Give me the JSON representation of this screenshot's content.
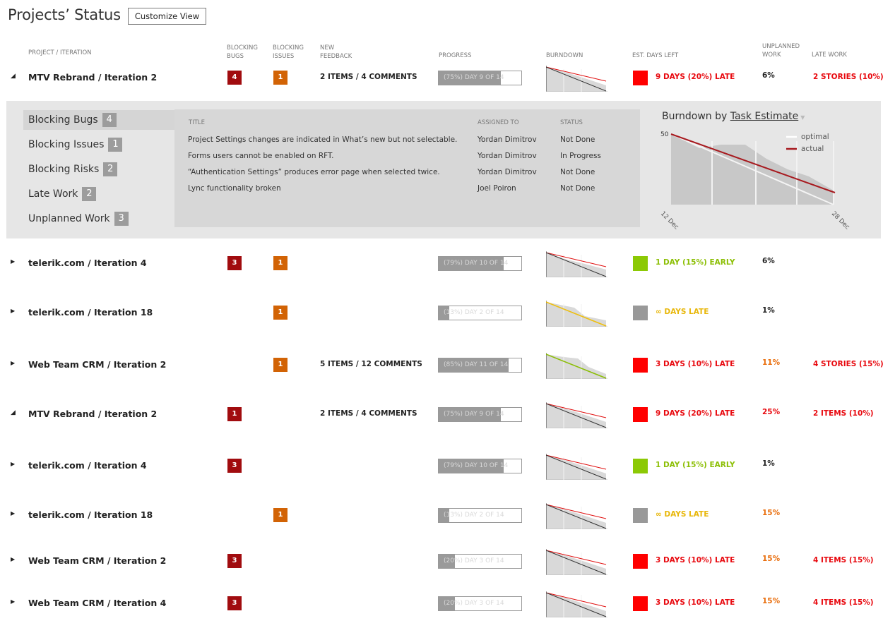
{
  "page": {
    "title": "Projects’ Status",
    "customize_label": "Customize View"
  },
  "columns": {
    "project": "Project / Iteration",
    "blocking_bugs": "Blocking Bugs",
    "blocking_issues": "Blocking Issues",
    "new_feedback": "New Feedback",
    "progress": "Progress",
    "burndown": "Burndown",
    "est_days_left": "Est. Days Left",
    "unplanned_work": "Unplanned Work",
    "late_work": "Late Work"
  },
  "rows": [
    {
      "expanded": true,
      "expander": "◢",
      "name": "MTV Rebrand / Iteration 2",
      "bugs": "4",
      "issues": "1",
      "feedback": "2 ITEMS / 4 COMMENTS",
      "progress_text": "(75%) DAY 9 OF 14",
      "progress_fraction": 0.75,
      "status_color": "#ff0000",
      "days_left": "9 DAYS (20%) LATE",
      "days_color": "red",
      "unplanned": "6%",
      "unplanned_color": "black",
      "late_work": "2 STORIES (10%)"
    },
    {
      "expanded": false,
      "expander": "▶",
      "name": "telerik.com / Iteration 4",
      "bugs": "3",
      "issues": "1",
      "feedback": "",
      "progress_text": "(79%) DAY 10 OF 14",
      "progress_fraction": 0.79,
      "status_color": "#8cc905",
      "days_left": "1 DAY (15%) EARLY",
      "days_color": "green",
      "unplanned": "6%",
      "unplanned_color": "black",
      "late_work": ""
    },
    {
      "expanded": false,
      "expander": "▶",
      "name": "telerik.com / Iteration 18",
      "bugs": "",
      "issues": "1",
      "feedback": "",
      "progress_text": "(13%) DAY 2 OF 14",
      "progress_fraction": 0.13,
      "status_color": "#999999",
      "days_left": "∞ DAYS LATE",
      "days_color": "yellow",
      "unplanned": "1%",
      "unplanned_color": "black",
      "late_work": ""
    },
    {
      "expanded": false,
      "expander": "▶",
      "name": "Web Team CRM / Iteration 2",
      "bugs": "",
      "issues": "1",
      "feedback": "5 ITEMS / 12 COMMENTS",
      "progress_text": "(85%) DAY 11 OF 14",
      "progress_fraction": 0.85,
      "status_color": "#ff0000",
      "days_left": "3 DAYS (10%) LATE",
      "days_color": "red",
      "unplanned": "11%",
      "unplanned_color": "orange",
      "late_work": "4 STORIES (15%)"
    },
    {
      "expanded": true,
      "expander": "◢",
      "name": "MTV Rebrand / Iteration 2",
      "bugs": "1",
      "issues": "",
      "feedback": "2 ITEMS / 4 COMMENTS",
      "progress_text": "(75%) DAY 9 OF 14",
      "progress_fraction": 0.75,
      "status_color": "#ff0000",
      "days_left": "9 DAYS (20%) LATE",
      "days_color": "red",
      "unplanned": "25%",
      "unplanned_color": "red",
      "late_work": "2 ITEMS (10%)"
    },
    {
      "expanded": false,
      "expander": "▶",
      "name": "telerik.com / Iteration 4",
      "bugs": "3",
      "issues": "",
      "feedback": "",
      "progress_text": "(79%) DAY 10 OF 14",
      "progress_fraction": 0.79,
      "status_color": "#8cc905",
      "days_left": "1 DAY (15%) EARLY",
      "days_color": "green",
      "unplanned": "1%",
      "unplanned_color": "black",
      "late_work": ""
    },
    {
      "expanded": false,
      "expander": "▶",
      "name": "telerik.com / Iteration 18",
      "bugs": "",
      "issues": "1",
      "feedback": "",
      "progress_text": "(13%) DAY 2 OF 14",
      "progress_fraction": 0.13,
      "status_color": "#999999",
      "days_left": "∞ DAYS LATE",
      "days_color": "yellow",
      "unplanned": "15%",
      "unplanned_color": "orange",
      "late_work": ""
    },
    {
      "expanded": false,
      "expander": "▶",
      "name": "Web Team CRM / Iteration 2",
      "bugs": "3",
      "issues": "",
      "feedback": "",
      "progress_text": "(20%) DAY 3 OF 14",
      "progress_fraction": 0.2,
      "status_color": "#ff0000",
      "days_left": "3 DAYS (10%) LATE",
      "days_color": "red",
      "unplanned": "15%",
      "unplanned_color": "orange",
      "late_work": "4 ITEMS (15%)"
    },
    {
      "expanded": false,
      "expander": "▶",
      "name": "Web Team CRM / Iteration 4",
      "bugs": "3",
      "issues": "",
      "feedback": "",
      "progress_text": "(20%) DAY 3 OF 14",
      "progress_fraction": 0.2,
      "status_color": "#ff0000",
      "days_left": "3 DAYS (10%) LATE",
      "days_color": "red",
      "unplanned": "15%",
      "unplanned_color": "orange",
      "late_work": "4 ITEMS (15%)"
    }
  ],
  "detail": {
    "side_items": [
      {
        "label": "Blocking Bugs",
        "count": "4",
        "active": true
      },
      {
        "label": "Blocking Issues",
        "count": "1",
        "active": false
      },
      {
        "label": "Blocking Risks",
        "count": "2",
        "active": false
      },
      {
        "label": "Late Work",
        "count": "2",
        "active": false
      },
      {
        "label": "Unplanned Work",
        "count": "3",
        "active": false
      }
    ],
    "table_headers": {
      "title": "Title",
      "assigned": "Assigned To",
      "status": "Status"
    },
    "table_rows": [
      {
        "title": "Project Settings changes are indicated in What’s new but not selectable.",
        "assigned": "Yordan Dimitrov",
        "status": "Not Done"
      },
      {
        "title": "Forms users cannot be enabled on RFT.",
        "assigned": "Yordan Dimitrov",
        "status": "In Progress"
      },
      {
        "title": "“Authentication Settings” produces error page when selected twice.",
        "assigned": "Yordan Dimitrov",
        "status": "Not Done"
      },
      {
        "title": "Lync functionality broken",
        "assigned": "Joel Poiron",
        "status": "Not Done"
      }
    ],
    "chart_title_prefix": "Burndown by",
    "chart_title_link": "Task Estimate",
    "chart_legend": {
      "optimal": "optimal",
      "actual": "actual"
    },
    "chart_y_label": "50",
    "chart_x_start": "12 Dec",
    "chart_x_end": "28 Dec"
  },
  "chart_data": {
    "type": "area",
    "title": "Burndown by Task Estimate",
    "x": [
      "12 Dec",
      "28 Dec"
    ],
    "ymax": 50,
    "series": [
      {
        "name": "optimal",
        "values": [
          50,
          0
        ]
      },
      {
        "name": "actual",
        "values": [
          50,
          8
        ]
      }
    ]
  },
  "colors": {
    "bug": "#a10c0f",
    "issue": "#d26305",
    "late": "#e8080e",
    "early": "#8cbf05",
    "infinite": "#e8b70a",
    "warn": "#e96e0d"
  }
}
